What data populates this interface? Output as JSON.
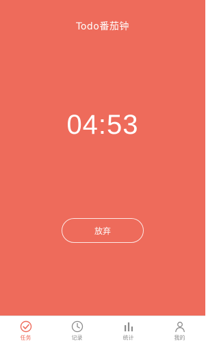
{
  "header": {
    "title": "Todo番茄钟"
  },
  "timer": {
    "display": "04:53"
  },
  "actions": {
    "give_up_label": "放弃"
  },
  "tabbar": {
    "items": [
      {
        "label": "任务",
        "icon": "check-circle-icon",
        "active": true
      },
      {
        "label": "记录",
        "icon": "clock-icon",
        "active": false
      },
      {
        "label": "统计",
        "icon": "bar-chart-icon",
        "active": false
      },
      {
        "label": "我的",
        "icon": "person-icon",
        "active": false
      }
    ]
  },
  "colors": {
    "primary": "#ee6b5b",
    "tab_inactive": "#8a8a8a",
    "tab_active": "#ee6b5b"
  }
}
